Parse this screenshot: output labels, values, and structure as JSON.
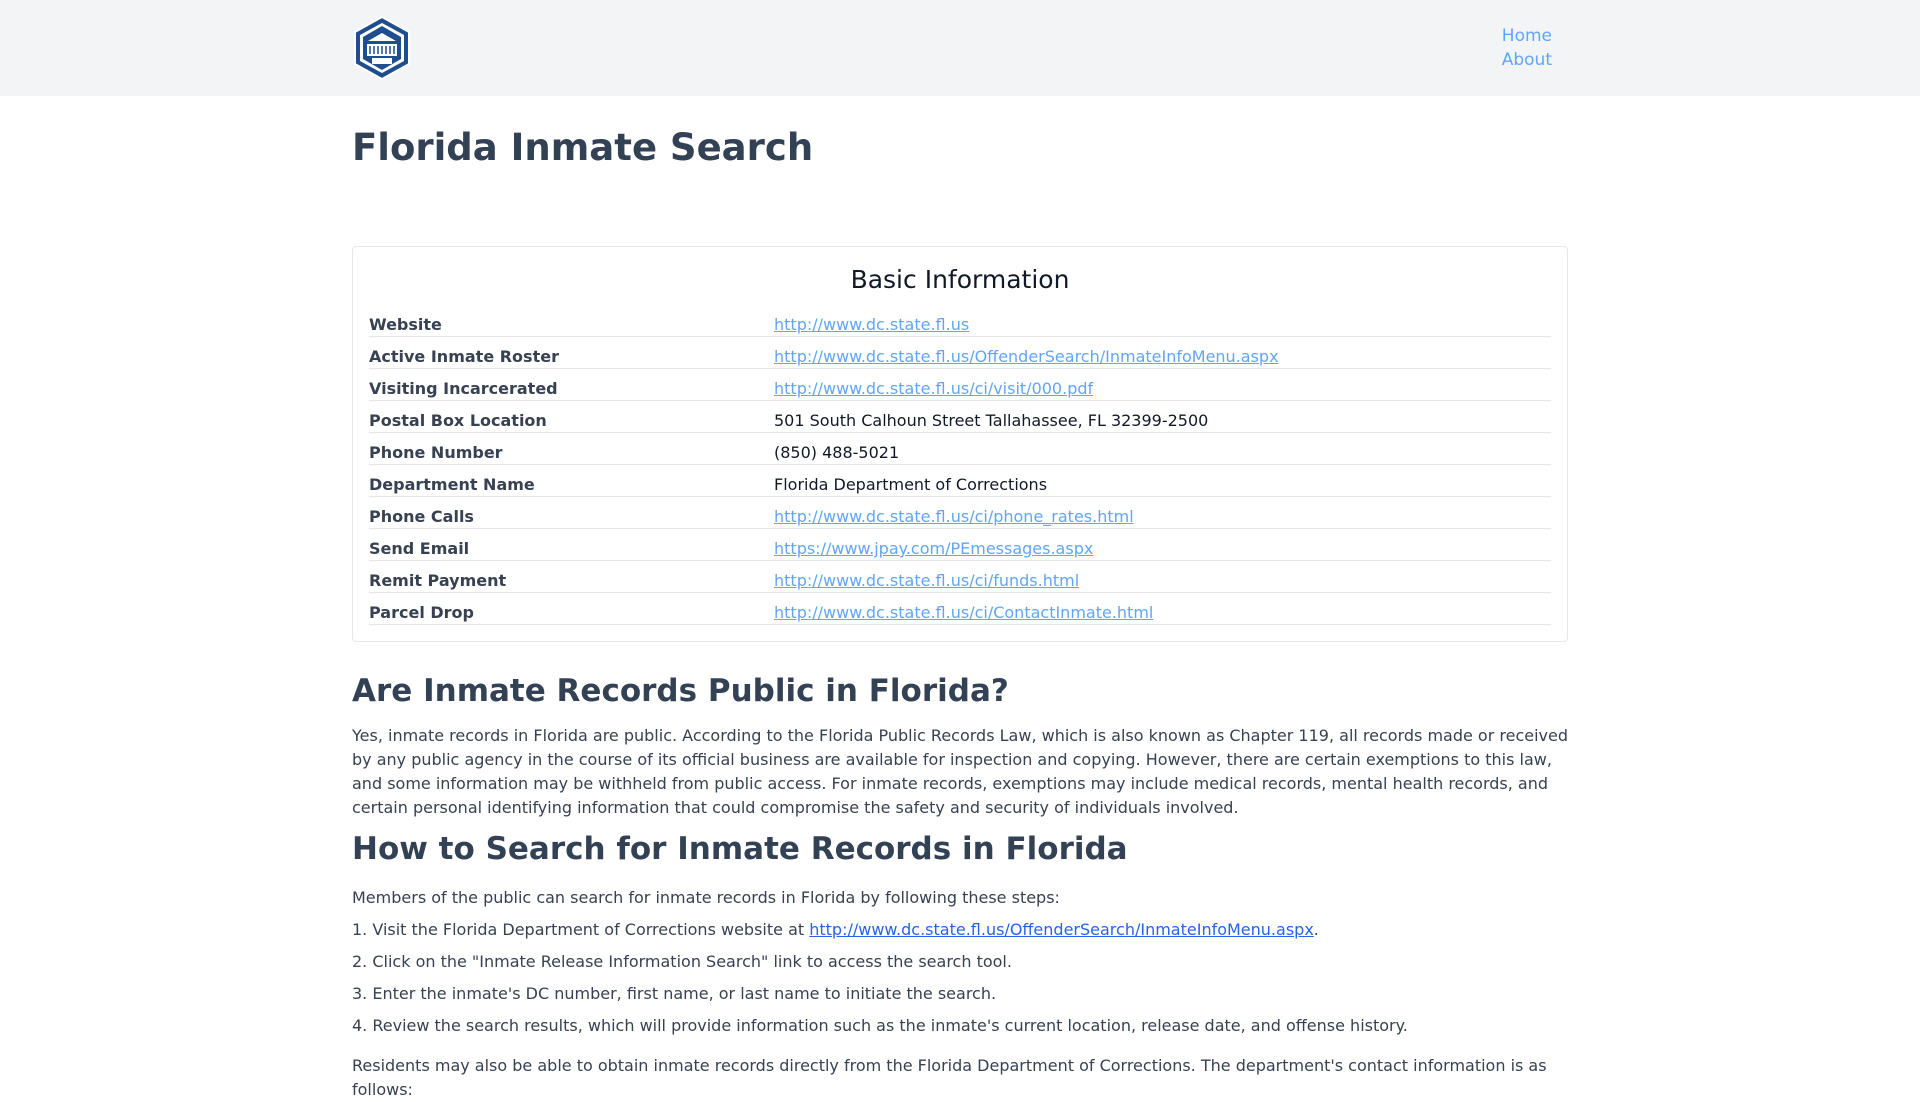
{
  "header": {
    "logo_alt": "Inmate Chamber logo",
    "nav": [
      "Home",
      "About"
    ]
  },
  "page_title": "Florida Inmate Search",
  "basic_info": {
    "title": "Basic Information",
    "rows": [
      {
        "label": "Website",
        "value": "http://www.dc.state.fl.us",
        "link": true
      },
      {
        "label": "Active Inmate Roster",
        "value": "http://www.dc.state.fl.us/OffenderSearch/InmateInfoMenu.aspx",
        "link": true
      },
      {
        "label": "Visiting Incarcerated",
        "value": "http://www.dc.state.fl.us/ci/visit/000.pdf",
        "link": true
      },
      {
        "label": "Postal Box Location",
        "value": "501 South Calhoun Street Tallahassee, FL 32399-2500",
        "link": false
      },
      {
        "label": "Phone Number",
        "value": "(850) 488-5021",
        "link": false
      },
      {
        "label": "Department Name",
        "value": "Florida Department of Corrections",
        "link": false
      },
      {
        "label": "Phone Calls",
        "value": "http://www.dc.state.fl.us/ci/phone_rates.html",
        "link": true
      },
      {
        "label": "Send Email",
        "value": "https://www.jpay.com/PEmessages.aspx",
        "link": true
      },
      {
        "label": "Remit Payment",
        "value": "http://www.dc.state.fl.us/ci/funds.html",
        "link": true
      },
      {
        "label": "Parcel Drop",
        "value": "http://www.dc.state.fl.us/ci/ContactInmate.html",
        "link": true
      }
    ]
  },
  "section1": {
    "heading": "Are Inmate Records Public in Florida?",
    "paragraph": "Yes, inmate records in Florida are public. According to the Florida Public Records Law, which is also known as Chapter 119, all records made or received by any public agency in the course of its official business are available for inspection and copying. However, there are certain exemptions to this law, and some information may be withheld from public access. For inmate records, exemptions may include medical records, mental health records, and certain personal identifying information that could compromise the safety and security of individuals involved."
  },
  "section2": {
    "heading": "How to Search for Inmate Records in Florida",
    "intro": "Members of the public can search for inmate records in Florida by following these steps:",
    "step1_prefix": "1. Visit the Florida Department of Corrections website at ",
    "step1_link": "http://www.dc.state.fl.us/OffenderSearch/InmateInfoMenu.aspx",
    "step1_suffix": ".",
    "step2": "2. Click on the \"Inmate Release Information Search\" link to access the search tool.",
    "step3": "3. Enter the inmate's DC number, first name, or last name to initiate the search.",
    "step4": "4. Review the search results, which will provide information such as the inmate's current location, release date, and offense history.",
    "residents": "Residents may also be able to obtain inmate records directly from the Florida Department of Corrections. The department's contact information is as follows:"
  }
}
